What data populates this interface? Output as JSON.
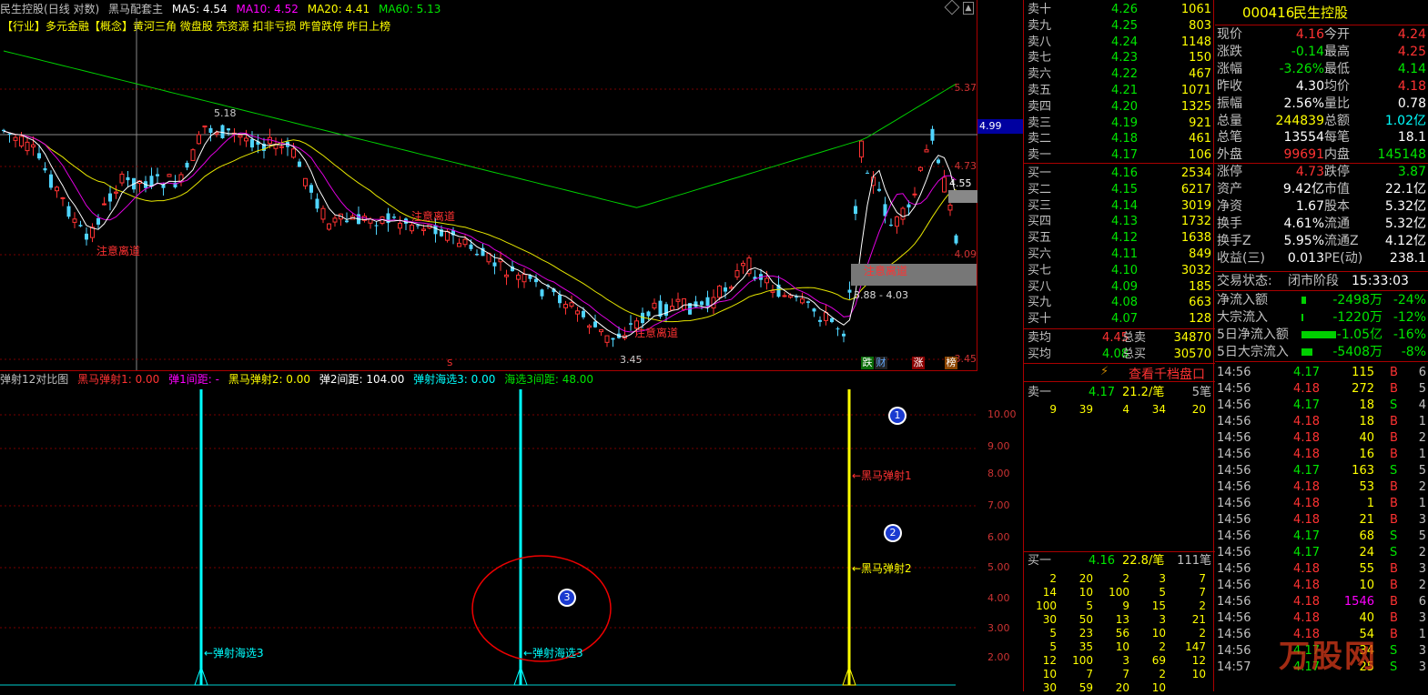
{
  "top": {
    "stock": "民生控股",
    "mode": "(日线 对数)",
    "indicator": "黑马配套主",
    "ma5": "MA5: 4.54",
    "ma10": "MA10: 4.52",
    "ma20": "MA20: 4.41",
    "ma60": "MA60: 5.13"
  },
  "tags": "【行业】多元金融【概念】黄河三角 微盘股 壳资源 扣非亏损 昨曾跌停 昨日上榜",
  "price_axis": [
    "5.37",
    "4.73",
    "4.09",
    "3.45"
  ],
  "price_marker": "4.99",
  "annotations": {
    "high": "5.18",
    "low": "3.45",
    "last": "4.55",
    "range": "3.88 - 4.03",
    "warn1": "注意离道",
    "warn2": "注意离道",
    "warn3": "注意离道",
    "warn4": "注意离道",
    "badges": [
      "跌",
      "财",
      "涨",
      "榜"
    ],
    "s_mark": "S"
  },
  "sub": {
    "title": "弹射12对比图",
    "f1": "黑马弹射1: 0.00",
    "f2": "弹1间距: -",
    "f3": "黑马弹射2: 0.00",
    "f4": "弹2间距: 104.00",
    "f5": "弹射海选3: 0.00",
    "f6": "海选3间距: 48.00",
    "axis": [
      "10.00",
      "9.00",
      "8.00",
      "7.00",
      "6.00",
      "5.00",
      "4.00",
      "3.00",
      "2.00"
    ],
    "lab_hx1": "←弹射海选3",
    "lab_hx2": "←弹射海选3",
    "lab_h1": "←黑马弹射1",
    "lab_h2": "←黑马弹射2",
    "c1": "1",
    "c2": "2",
    "c3": "3"
  },
  "asks": [
    {
      "label": "卖十",
      "price": "4.26",
      "vol": "1061"
    },
    {
      "label": "卖九",
      "price": "4.25",
      "vol": "803"
    },
    {
      "label": "卖八",
      "price": "4.24",
      "vol": "1148"
    },
    {
      "label": "卖七",
      "price": "4.23",
      "vol": "150"
    },
    {
      "label": "卖六",
      "price": "4.22",
      "vol": "467"
    },
    {
      "label": "卖五",
      "price": "4.21",
      "vol": "1071"
    },
    {
      "label": "卖四",
      "price": "4.20",
      "vol": "1325"
    },
    {
      "label": "卖三",
      "price": "4.19",
      "vol": "921"
    },
    {
      "label": "卖二",
      "price": "4.18",
      "vol": "461"
    },
    {
      "label": "卖一",
      "price": "4.17",
      "vol": "106"
    }
  ],
  "bids": [
    {
      "label": "买一",
      "price": "4.16",
      "vol": "2534"
    },
    {
      "label": "买二",
      "price": "4.15",
      "vol": "6217"
    },
    {
      "label": "买三",
      "price": "4.14",
      "vol": "3019"
    },
    {
      "label": "买四",
      "price": "4.13",
      "vol": "1732"
    },
    {
      "label": "买五",
      "price": "4.12",
      "vol": "1638"
    },
    {
      "label": "买六",
      "price": "4.11",
      "vol": "849"
    },
    {
      "label": "买七",
      "price": "4.10",
      "vol": "3032"
    },
    {
      "label": "买八",
      "price": "4.09",
      "vol": "185"
    },
    {
      "label": "买九",
      "price": "4.08",
      "vol": "663"
    },
    {
      "label": "买十",
      "price": "4.07",
      "vol": "128"
    }
  ],
  "avg": {
    "ask_label": "卖均",
    "ask_price": "4.45",
    "ask_total_label": "总卖",
    "ask_total": "34870",
    "bid_label": "买均",
    "bid_price": "4.08",
    "bid_total_label": "总买",
    "bid_total": "30570"
  },
  "qianbang": "查看千档盘口",
  "sell1": {
    "label": "卖一",
    "price": "4.17",
    "per": "21.2/笔",
    "count": "5笔",
    "orders": [
      "9",
      "39",
      "4",
      "34",
      "20"
    ]
  },
  "buy1": {
    "label": "买一",
    "price": "4.16",
    "per": "22.8/笔",
    "count": "111笔",
    "orders": [
      [
        "2",
        "20",
        "2",
        "3",
        "7"
      ],
      [
        "14",
        "10",
        "100",
        "5",
        "7"
      ],
      [
        "100",
        "5",
        "9",
        "15",
        "2"
      ],
      [
        "30",
        "50",
        "13",
        "3",
        "21"
      ],
      [
        "5",
        "23",
        "56",
        "10",
        "2"
      ],
      [
        "5",
        "35",
        "10",
        "2",
        "147"
      ],
      [
        "12",
        "100",
        "3",
        "69",
        "12"
      ],
      [
        "10",
        "7",
        "7",
        "2",
        "10"
      ],
      [
        "30",
        "59",
        "20",
        "10",
        ""
      ]
    ]
  },
  "quote": {
    "code": "000416",
    "name": "民生控股",
    "rows": [
      [
        "现价",
        "4.16",
        "今开",
        "4.24"
      ],
      [
        "涨跌",
        "-0.14",
        "最高",
        "4.25"
      ],
      [
        "涨幅",
        "-3.26%",
        "最低",
        "4.14"
      ],
      [
        "昨收",
        "4.30",
        "均价",
        "4.18"
      ],
      [
        "振幅",
        "2.56%",
        "量比",
        "0.78"
      ],
      [
        "总量",
        "244839",
        "总额",
        "1.02亿"
      ],
      [
        "总笔",
        "13554",
        "每笔",
        "18.1"
      ],
      [
        "外盘",
        "99691",
        "内盘",
        "145148"
      ],
      [
        "涨停",
        "4.73",
        "跌停",
        "3.87"
      ],
      [
        "资产",
        "9.42亿",
        "市值",
        "22.1亿"
      ],
      [
        "净资",
        "1.67",
        "股本",
        "5.32亿"
      ],
      [
        "换手",
        "4.61%",
        "流通",
        "5.32亿"
      ],
      [
        "换手Z",
        "5.95%",
        "流通Z",
        "4.12亿"
      ],
      [
        "收益(三)",
        "0.013",
        "PE(动)",
        "238.1"
      ]
    ],
    "status_label": "交易状态:",
    "status": "闭市阶段",
    "time": "15:33:03",
    "flows": [
      [
        "净流入额",
        "-2498万",
        "-24%"
      ],
      [
        "大宗流入",
        "-1220万",
        "-12%"
      ],
      [
        "5日净流入额",
        "-1.05亿",
        "-16%"
      ],
      [
        "5日大宗流入",
        "-5408万",
        "-8%"
      ]
    ]
  },
  "ticks": [
    [
      "14:56",
      "4.17",
      "115",
      "B",
      "6"
    ],
    [
      "14:56",
      "4.18",
      "272",
      "B",
      "5"
    ],
    [
      "14:56",
      "4.17",
      "18",
      "S",
      "4"
    ],
    [
      "14:56",
      "4.18",
      "18",
      "B",
      "1"
    ],
    [
      "14:56",
      "4.18",
      "40",
      "B",
      "2"
    ],
    [
      "14:56",
      "4.18",
      "16",
      "B",
      "1"
    ],
    [
      "14:56",
      "4.17",
      "163",
      "S",
      "5"
    ],
    [
      "14:56",
      "4.18",
      "53",
      "B",
      "2"
    ],
    [
      "14:56",
      "4.18",
      "1",
      "B",
      "1"
    ],
    [
      "14:56",
      "4.18",
      "21",
      "B",
      "3"
    ],
    [
      "14:56",
      "4.17",
      "68",
      "S",
      "5"
    ],
    [
      "14:56",
      "4.17",
      "24",
      "S",
      "2"
    ],
    [
      "14:56",
      "4.18",
      "55",
      "B",
      "3"
    ],
    [
      "14:56",
      "4.18",
      "10",
      "B",
      "2"
    ],
    [
      "14:56",
      "4.18",
      "1546",
      "B",
      "6"
    ],
    [
      "14:56",
      "4.18",
      "40",
      "B",
      "3"
    ],
    [
      "14:56",
      "4.18",
      "54",
      "B",
      "1"
    ],
    [
      "14:56",
      "4.17",
      "34",
      "S",
      "3"
    ],
    [
      "14:57",
      "4.17",
      "25",
      "S",
      "3"
    ]
  ],
  "watermark": "万股网"
}
